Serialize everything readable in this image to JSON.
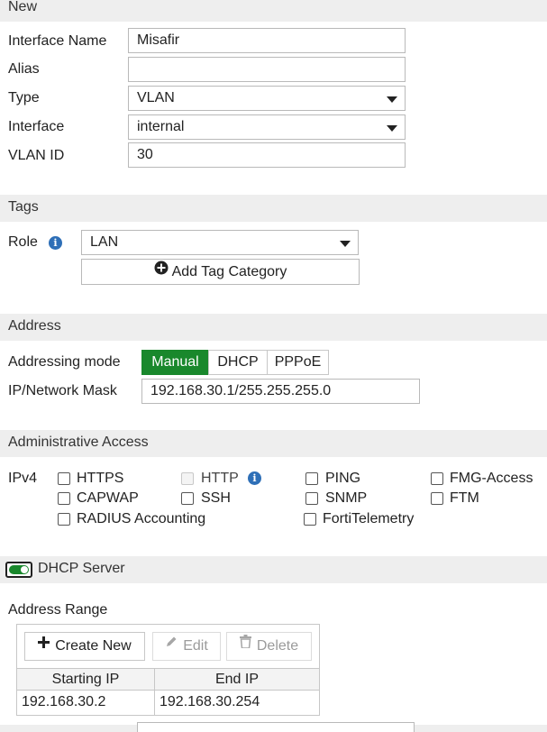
{
  "new": {
    "header": "New",
    "interface_name_label": "Interface Name",
    "interface_name_value": "Misafir",
    "alias_label": "Alias",
    "alias_value": "",
    "type_label": "Type",
    "type_value": "VLAN",
    "interface_label": "Interface",
    "interface_value": "internal",
    "vlan_id_label": "VLAN ID",
    "vlan_id_value": "30"
  },
  "tags": {
    "header": "Tags",
    "role_label": "Role",
    "role_value": "LAN",
    "add_tag_label": "Add Tag Category"
  },
  "address": {
    "header": "Address",
    "addressing_mode_label": "Addressing mode",
    "modes": [
      "Manual",
      "DHCP",
      "PPPoE"
    ],
    "active_mode": "Manual",
    "ip_mask_label": "IP/Network Mask",
    "ip_mask_value": "192.168.30.1/255.255.255.0"
  },
  "admin_access": {
    "header": "Administrative Access",
    "ipv4_label": "IPv4",
    "options": [
      {
        "label": "HTTPS",
        "checked": false,
        "disabled": false
      },
      {
        "label": "HTTP",
        "checked": false,
        "disabled": true
      },
      {
        "label": "PING",
        "checked": false,
        "disabled": false
      },
      {
        "label": "FMG-Access",
        "checked": false,
        "disabled": false
      },
      {
        "label": "CAPWAP",
        "checked": false,
        "disabled": false
      },
      {
        "label": "SSH",
        "checked": false,
        "disabled": false
      },
      {
        "label": "SNMP",
        "checked": false,
        "disabled": false
      },
      {
        "label": "FTM",
        "checked": false,
        "disabled": false
      },
      {
        "label": "RADIUS Accounting",
        "checked": false,
        "disabled": false
      },
      {
        "label": "FortiTelemetry",
        "checked": false,
        "disabled": false
      }
    ]
  },
  "dhcp_server": {
    "label": "DHCP Server",
    "enabled": true,
    "address_range_label": "Address Range",
    "toolbar": {
      "create_new": "Create New",
      "edit": "Edit",
      "delete": "Delete"
    },
    "columns": [
      "Starting IP",
      "End IP"
    ],
    "rows": [
      [
        "192.168.30.2",
        "192.168.30.254"
      ]
    ]
  },
  "colors": {
    "accent_green": "#19882c",
    "info_blue": "#2e6fb7",
    "section_bg": "#eeeeee"
  }
}
